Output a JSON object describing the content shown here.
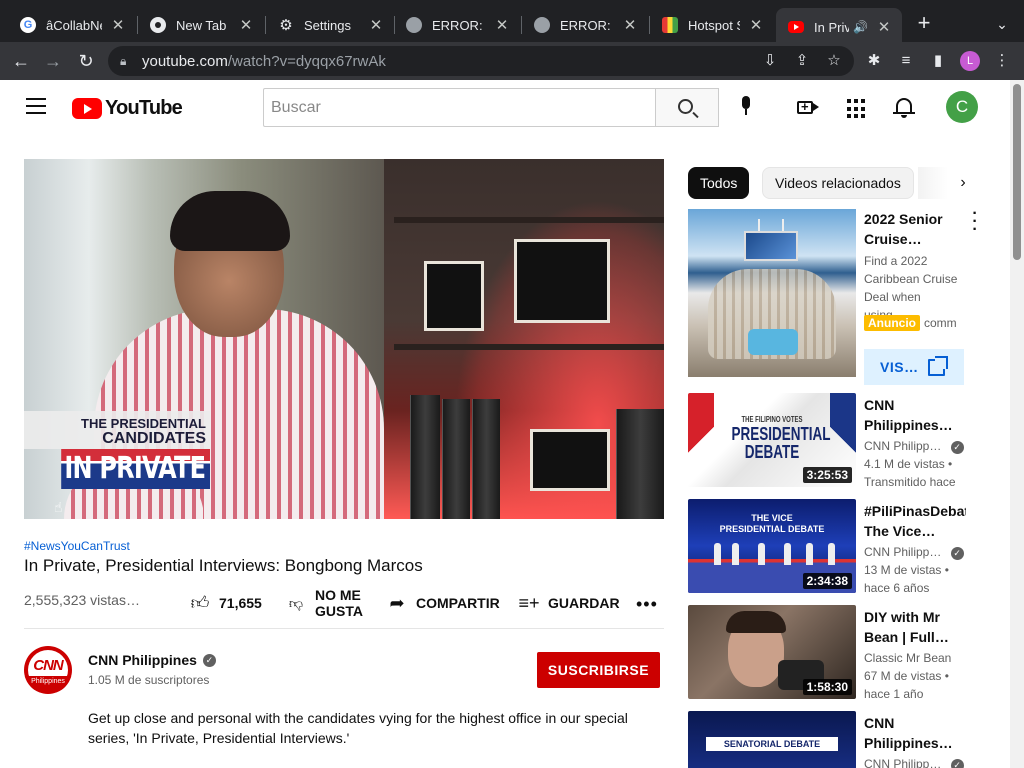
{
  "browser": {
    "tabs": [
      {
        "title": "âCollabNet",
        "favicon": "google-icon"
      },
      {
        "title": "New Tab",
        "favicon": "chrome-icon"
      },
      {
        "title": "Settings",
        "favicon": "gear-icon"
      },
      {
        "title": "ERROR: Th",
        "favicon": "globe-icon"
      },
      {
        "title": "ERROR: Th",
        "favicon": "globe-icon"
      },
      {
        "title": "Hotspot Sh",
        "favicon": "hotspot-icon"
      },
      {
        "title": "In Priva",
        "favicon": "youtube-icon",
        "active": true
      }
    ],
    "url_host": "youtube.com",
    "url_path": "/watch?v=dyqqx67rwAk",
    "profile_initial": "L"
  },
  "header": {
    "logo_text": "YouTube",
    "search_placeholder": "Buscar",
    "avatar_initial": "C"
  },
  "player": {
    "overlay_line1": "THE PRESIDENTIAL",
    "overlay_line2": "CANDIDATES",
    "overlay_line3": "IN PRIVATE"
  },
  "video": {
    "hashtag": "#NewsYouCanTrust",
    "title": "In Private, Presidential Interviews: Bongbong Marcos",
    "views": "2,555,323 vistas…",
    "likes": "71,655",
    "dislike_line1": "NO ME",
    "dislike_line2": "GUSTA",
    "share": "COMPARTIR",
    "save": "GUARDAR"
  },
  "channel": {
    "logo_text": "CNN",
    "logo_sub": "Philippines",
    "name": "CNN Philippines",
    "subscribers": "1.05 M de suscriptores",
    "subscribe": "SUSCRIBIRSE",
    "description": "Get up close and personal with the candidates vying for the highest office in our special series, 'In Private, Presidential Interviews.'"
  },
  "sidebar": {
    "chips": [
      "Todos",
      "Videos relacionados"
    ],
    "ad": {
      "title": "2022 Senior Cruise…",
      "description": "Find a 2022 Caribbean Cruise Deal when using…",
      "badge": "Anuncio",
      "advertiser": "comm…",
      "visit": "VIS…"
    },
    "recommendations": [
      {
        "title": "CNN Philippines…",
        "channel": "CNN Philipp…",
        "views": "4.1 M de vistas •",
        "age": "Transmitido hace",
        "duration": "3:25:53",
        "thumb_text_small": "THE FILIPINO VOTES",
        "thumb_text": "PRESIDENTIAL DEBATE"
      },
      {
        "title": "#PiliPinasDebat The Vice…",
        "channel": "CNN Philipp…",
        "views": "13 M de vistas •",
        "age": "hace 6 años",
        "duration": "2:34:38",
        "thumb_text": "THE VICE PRESIDENTIAL DEBATE"
      },
      {
        "title": "DIY with Mr Bean | Full…",
        "channel": "Classic Mr Bean",
        "views": "67 M de vistas •",
        "age": "hace 1 año",
        "duration": "1:58:30"
      },
      {
        "title": "CNN Philippines…",
        "channel": "CNN Philipp…",
        "thumb_text": "SENATORIAL DEBATE"
      }
    ]
  }
}
